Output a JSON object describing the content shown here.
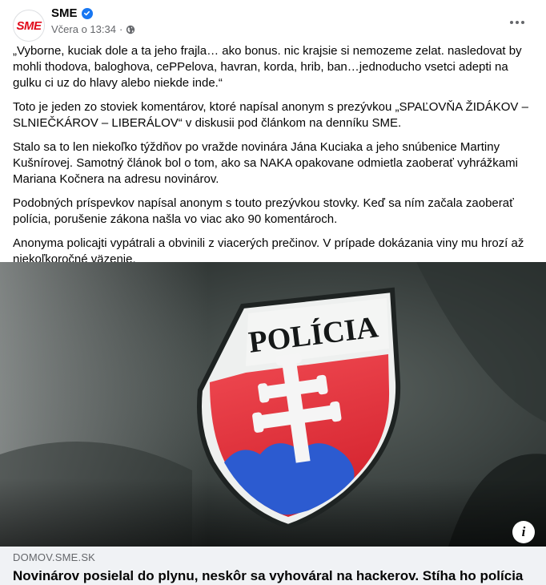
{
  "post": {
    "page_name": "SME",
    "avatar_text": "SME",
    "timestamp": "Včera o 13:34",
    "separator": "·",
    "privacy_icon": "globe-icon",
    "verified_icon": "verified-badge-icon",
    "more_icon": "more-options-icon"
  },
  "body": {
    "paragraphs": [
      "„Vyborne, kuciak dole a ta jeho frajla… ako bonus. nic krajsie si nemozeme zelat. nasledovat by mohli thodova, baloghova, cePPelova, havran, korda, hrib, ban…jednoducho vsetci adepti na gulku ci uz do hlavy alebo niekde inde.“",
      "Toto je jeden zo stoviek komentárov, ktoré napísal anonym s prezývkou „SPAĽOVŇA ŽIDÁKOV – SLNIEČKÁROV – LIBERÁLOV“ v diskusii pod článkom na denníku SME.",
      "Stalo sa to len niekoľko týždňov po vražde novinára Jána Kuciaka a jeho snúbenice Martiny Kušnírovej. Samotný článok bol o tom, ako sa NAKA opakovane odmietla zaoberať vyhrážkami Mariana Kočnera na adresu novinárov.",
      "Podobných príspevkov napísal anonym s touto prezývkou stovky. Keď sa ním začala zaoberať polícia, porušenie zákona našla vo viac ako 90 komentároch.",
      "Anonyma policajti vypátrali a obvinili z viacerých prečinov. V prípade dokázania viny mu hrozí až niekoľkoročné väzenie."
    ]
  },
  "image": {
    "patch_text": "POLÍCIA",
    "info_label": "i"
  },
  "link": {
    "domain": "DOMOV.SME.SK",
    "title": "Novinárov posielal do plynu, neskôr sa vyhováral na hackerov. Stíha ho polícia"
  },
  "colors": {
    "brand_red": "#e10a1a",
    "verified_blue": "#1877f2",
    "secondary_text": "#65676b",
    "link_bg": "#f0f2f5"
  }
}
